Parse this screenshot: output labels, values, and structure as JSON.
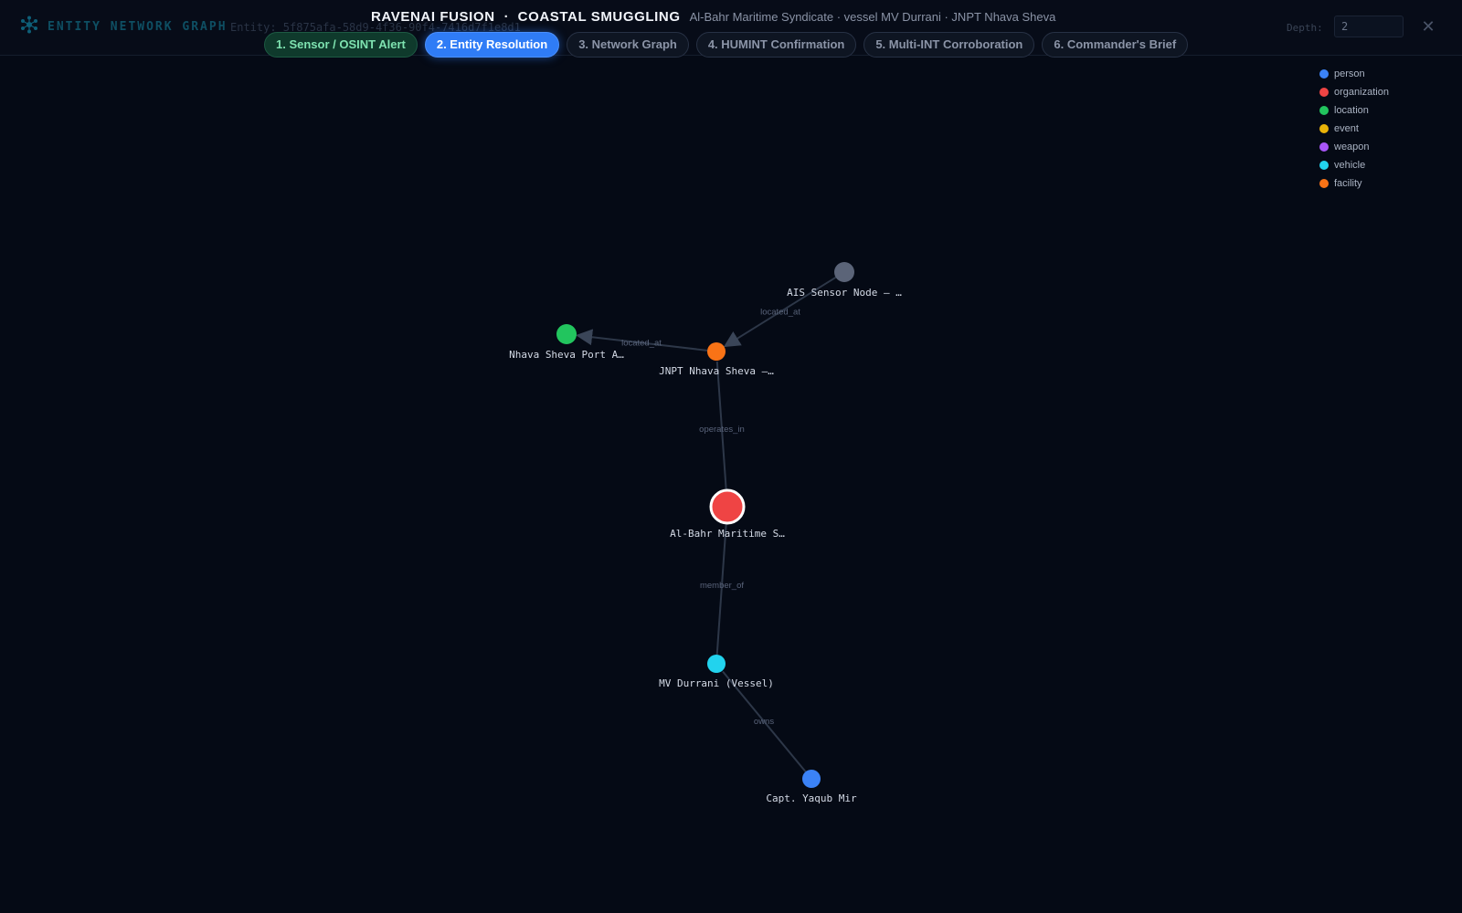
{
  "header": {
    "brand": "ENTITY NETWORK GRAPH",
    "entity_id": "Entity: 5f875afa-58d9-4f36-90f4-7416d7f1e8d1",
    "depth_label": "Depth:",
    "depth_value": "2",
    "close_label": "✕"
  },
  "title": {
    "app": "RAVENAI FUSION",
    "separator": "·",
    "scenario": "COASTAL SMUGGLING",
    "subtitle": "Al-Bahr Maritime Syndicate · vessel MV Durrani · JNPT Nhava Sheva"
  },
  "steps": [
    {
      "label": "1. Sensor / OSINT Alert",
      "state": "done"
    },
    {
      "label": "2. Entity Resolution",
      "state": "active"
    },
    {
      "label": "3. Network Graph",
      "state": "pending"
    },
    {
      "label": "4. HUMINT Confirmation",
      "state": "pending"
    },
    {
      "label": "5. Multi-INT Corroboration",
      "state": "pending"
    },
    {
      "label": "6. Commander's Brief",
      "state": "pending"
    }
  ],
  "legend": [
    {
      "label": "person",
      "color": "#3b82f6"
    },
    {
      "label": "organization",
      "color": "#ef4444"
    },
    {
      "label": "location",
      "color": "#22c55e"
    },
    {
      "label": "event",
      "color": "#eab308"
    },
    {
      "label": "weapon",
      "color": "#a855f7"
    },
    {
      "label": "vehicle",
      "color": "#22d3ee"
    },
    {
      "label": "facility",
      "color": "#f97316"
    }
  ],
  "graph": {
    "nodes": [
      {
        "id": "sensor",
        "label": "AIS Sensor Node — …",
        "type": "sensor",
        "color": "#5b6478"
      },
      {
        "id": "port",
        "label": "Nhava Sheva Port A…",
        "type": "location",
        "color": "#22c55e"
      },
      {
        "id": "jnpt",
        "label": "JNPT Nhava Sheva —…",
        "type": "facility",
        "color": "#f97316"
      },
      {
        "id": "org",
        "label": "Al-Bahr Maritime S…",
        "type": "organization",
        "color": "#ef4444",
        "focus": true
      },
      {
        "id": "vessel",
        "label": "MV Durrani (Vessel)",
        "type": "vehicle",
        "color": "#22d3ee"
      },
      {
        "id": "captain",
        "label": "Capt. Yaqub Mir",
        "type": "person",
        "color": "#3b82f6"
      }
    ],
    "edges": [
      {
        "source": "sensor",
        "target": "jnpt",
        "label": "located_at",
        "arrow": true
      },
      {
        "source": "jnpt",
        "target": "port",
        "label": "located_at",
        "arrow": true
      },
      {
        "source": "org",
        "target": "jnpt",
        "label": "operates_in",
        "arrow": false
      },
      {
        "source": "vessel",
        "target": "org",
        "label": "member_of",
        "arrow": false
      },
      {
        "source": "captain",
        "target": "vessel",
        "label": "owns",
        "arrow": false
      }
    ]
  }
}
